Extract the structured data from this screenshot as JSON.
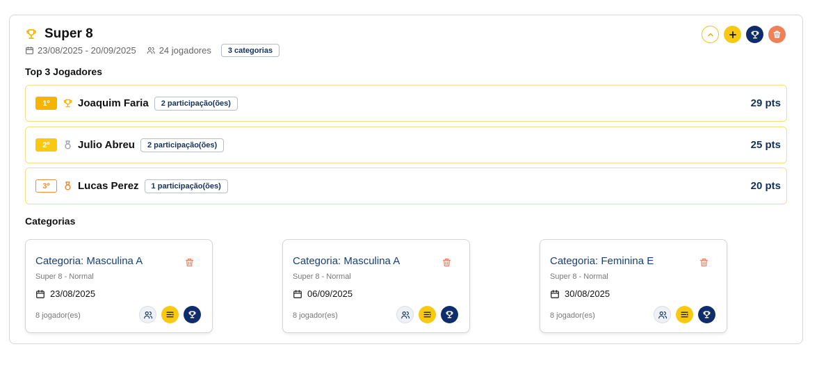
{
  "tournament": {
    "title": "Super 8",
    "dates": "23/08/2025 - 20/09/2025",
    "players": "24 jogadores",
    "categories_badge": "3 categorias"
  },
  "colors": {
    "accent_yellow": "#f7c913",
    "navy": "#0f2d6b",
    "delete_orange": "#f08157",
    "link_blue": "#15407a"
  },
  "icons": {
    "title": "trophy-icon",
    "calendar": "calendar-icon",
    "users": "users-icon",
    "collapse": "chevron-up-icon",
    "add": "plus-icon",
    "trophy": "trophy-icon",
    "delete": "trash-icon",
    "list": "list-icon"
  },
  "top3": {
    "heading": "Top 3 Jogadores",
    "players": [
      {
        "rank": "1º",
        "name": "Joaquim Faria",
        "participations": "2 participação(ões)",
        "points": "29 pts",
        "medal": "gold-trophy-icon"
      },
      {
        "rank": "2º",
        "name": "Julio Abreu",
        "participations": "2 participação(ões)",
        "points": "25 pts",
        "medal": "silver-medal-icon"
      },
      {
        "rank": "3º",
        "name": "Lucas Perez",
        "participations": "1 participação(ões)",
        "points": "20 pts",
        "medal": "bronze-medal-icon"
      }
    ]
  },
  "categories": {
    "heading": "Categorias",
    "items": [
      {
        "title": "Categoria: Masculina A",
        "subtitle": "Super 8 - Normal",
        "date": "23/08/2025",
        "players": "8 jogador(es)"
      },
      {
        "title": "Categoria: Masculina A",
        "subtitle": "Super 8 - Normal",
        "date": "06/09/2025",
        "players": "8 jogador(es)"
      },
      {
        "title": "Categoria: Feminina E",
        "subtitle": "Super 8 - Normal",
        "date": "30/08/2025",
        "players": "8 jogador(es)"
      }
    ]
  }
}
